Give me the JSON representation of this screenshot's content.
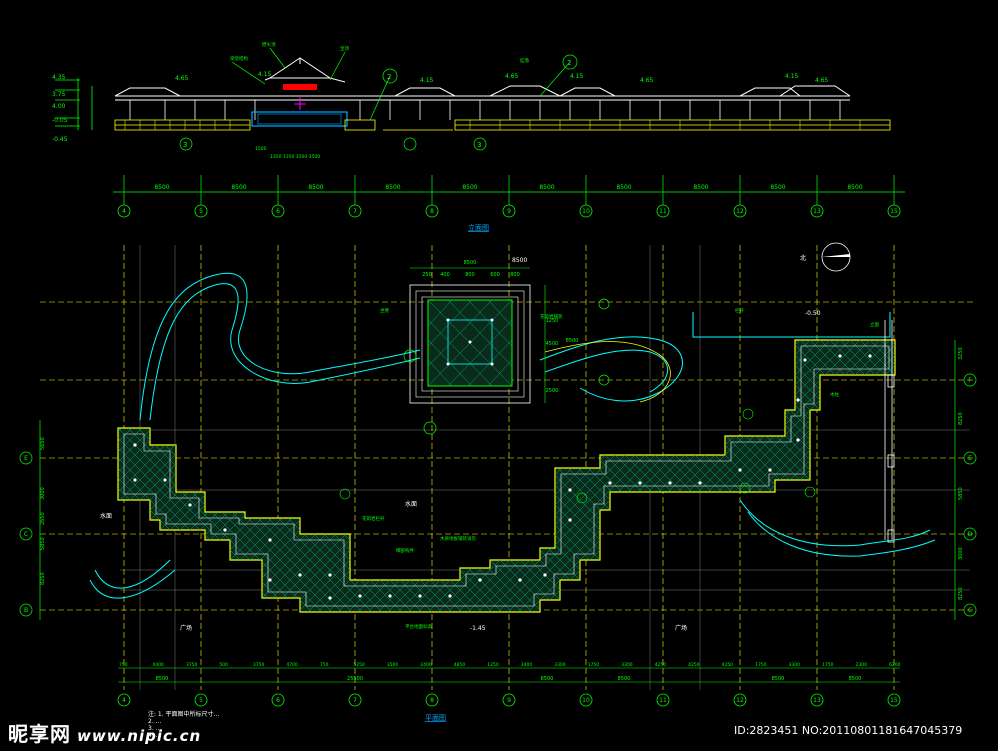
{
  "elevation": {
    "title": "立面图",
    "levels": [
      "4.35",
      "3.75",
      "4.00",
      "-0.05",
      "-0.45",
      "4.65",
      "4.15",
      "4.65",
      "4.15",
      "4.65",
      "4.15",
      "4.65",
      "4.15"
    ],
    "axis_labels": [
      "4",
      "5",
      "6",
      "7",
      "8",
      "9",
      "10",
      "11",
      "12",
      "13",
      "15"
    ],
    "spans": [
      "8500",
      "8500",
      "8500",
      "8500",
      "8500",
      "8500",
      "8500",
      "8500",
      "8500",
      "8500"
    ],
    "tags": [
      "2",
      "2",
      "3",
      "3"
    ]
  },
  "plan": {
    "title": "平面图",
    "north": "北",
    "grid_rows_left": [
      "E",
      "D",
      "C",
      "B"
    ],
    "grid_rows_right": [
      "F",
      "E",
      "D",
      "C"
    ],
    "dims_left": [
      "5650",
      "3000",
      "2650",
      "5850",
      "8250"
    ],
    "dims_right": [
      "3250",
      "8250",
      "5850",
      "3000",
      "8250"
    ],
    "dims_bottom_fine": [
      "750",
      "4400",
      "3750",
      "500",
      "3750",
      "4700",
      "750",
      "5250",
      "3500",
      "2400",
      "4850",
      "1250",
      "3400",
      "3300",
      "1750",
      "3300",
      "4250",
      "4250",
      "4250",
      "1750",
      "3300",
      "1750",
      "2300",
      "6200"
    ],
    "dims_bottom_main": [
      "8500",
      "25500",
      "8500",
      "8500",
      "8500",
      "8500"
    ],
    "labels": [
      "水面",
      "水面",
      "广场",
      "广场",
      "-1.45",
      "-0.50",
      "8500"
    ],
    "pavilion_dims": [
      "8500",
      "250",
      "400",
      "800",
      "600",
      "800",
      "8500",
      "1250",
      "4500",
      "2500"
    ]
  },
  "watermark": {
    "brand": "昵享网",
    "url": "www.nipic.cn",
    "id": "ID:2823451 NO:20110801181647045379"
  },
  "notes": [
    "注: 1. 平面图中所标尺寸…",
    "2. …",
    "3. …",
    "4. …"
  ]
}
